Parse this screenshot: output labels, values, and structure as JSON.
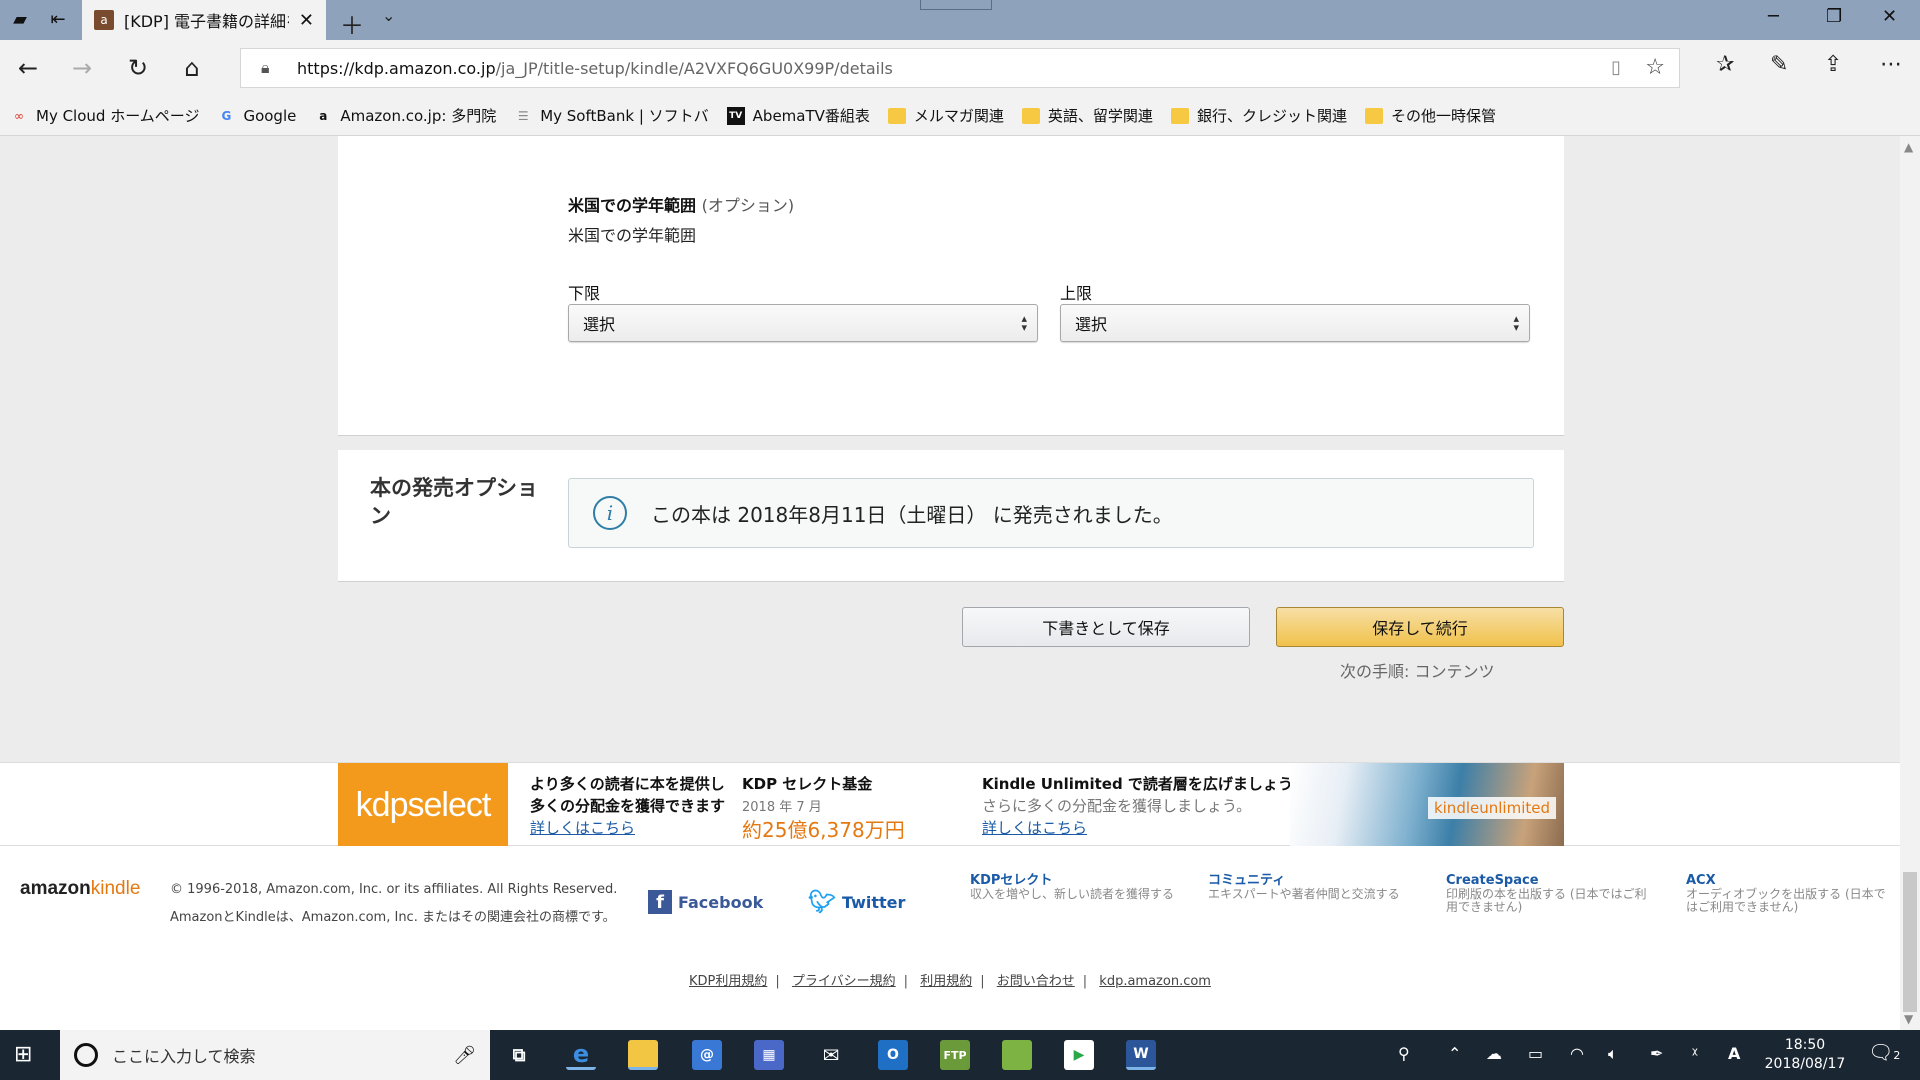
{
  "browser": {
    "tab_title": "[KDP] 電子書籍の詳細を:",
    "tab_favicon": "amazon-icon",
    "url_host": "https://kdp.amazon.co.jp",
    "url_path": "/ja_JP/title-setup/kindle/A2VXFQ6GU0X99P/details",
    "favorites": [
      {
        "label": "My Cloud ホームページ",
        "icon": "cloud-icon"
      },
      {
        "label": "Google",
        "icon": "google-icon"
      },
      {
        "label": "Amazon.co.jp: 多門院",
        "icon": "amazon-icon"
      },
      {
        "label": "My SoftBank | ソフトバ",
        "icon": "softbank-icon"
      },
      {
        "label": "AbemaTV番組表",
        "icon": "tv-icon"
      },
      {
        "label": "メルマガ関連",
        "icon": "folder-icon"
      },
      {
        "label": "英語、留学関連",
        "icon": "folder-icon"
      },
      {
        "label": "銀行、クレジット関連",
        "icon": "folder-icon"
      },
      {
        "label": "その他一時保管",
        "icon": "folder-icon"
      }
    ]
  },
  "grade_range": {
    "title": "米国での学年範囲",
    "optional": "(オプション)",
    "subtitle": "米国での学年範囲",
    "lower_label": "下限",
    "upper_label": "上限",
    "lower_value": "選択",
    "upper_value": "選択"
  },
  "release": {
    "section_title": "本の発売オプション",
    "message": "この本は 2018年8月11日（土曜日） に発売されました。"
  },
  "actions": {
    "draft_label": "下書きとして保存",
    "save_label": "保存して続行",
    "next_step": "次の手順: コンテンツ"
  },
  "promo": {
    "kdp_logo": "kdpselect",
    "line1": "より多くの読者に本を提供し",
    "line2": "多くの分配金を獲得できます",
    "link1": "詳しくはこちら",
    "fund_title": "KDP セレクト基金",
    "fund_date": "2018 年 7 月",
    "fund_amount": "約25億6,378万円",
    "ku_title": "Kindle Unlimited で読者層を広げましょう。",
    "ku_sub": "さらに多くの分配金を獲得しましょう。",
    "link2": "詳しくはこちら",
    "ku_label": "kindleunlimited"
  },
  "footer": {
    "logo_a": "amazon",
    "logo_b": "kindle",
    "copyright": "© 1996-2018, Amazon.com, Inc. or its affiliates. All Rights Reserved.",
    "trademark": "AmazonとKindleは、Amazon.com, Inc. またはその関連会社の商標です。",
    "facebook": "Facebook",
    "twitter": "Twitter",
    "columns": [
      {
        "title": "KDPセレクト",
        "desc": "収入を増やし、新しい読者を獲得する"
      },
      {
        "title": "コミュニティ",
        "desc": "エキスパートや著者仲間と交流する"
      },
      {
        "title": "CreateSpace",
        "desc": "印刷版の本を出版する (日本ではご利用できません)"
      },
      {
        "title": "ACX",
        "desc": "オーディオブックを出版する (日本ではご利用できません)"
      }
    ],
    "legal": [
      "KDP利用規約",
      "プライバシー規約",
      "利用規約",
      "お問い合わせ",
      "kdp.amazon.com"
    ]
  },
  "taskbar": {
    "search_placeholder": "ここに入力して検索",
    "time": "18:50",
    "date": "2018/08/17",
    "notification_count": "2"
  }
}
